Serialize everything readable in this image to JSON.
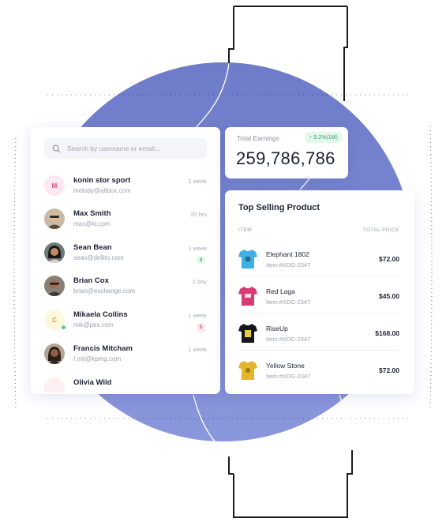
{
  "search": {
    "placeholder": "Search by username or email..."
  },
  "contacts": [
    {
      "name": "konin stor sport",
      "email": "melody@altbox.com",
      "time": "1 week",
      "avatar_initial": "M",
      "badge": ""
    },
    {
      "name": "Max Smith",
      "email": "max@kt.com",
      "time": "20 hrs",
      "avatar_initial": "",
      "badge": ""
    },
    {
      "name": "Sean Bean",
      "email": "sean@dellito.com",
      "time": "1 week",
      "avatar_initial": "",
      "badge": "2"
    },
    {
      "name": "Brian Cox",
      "email": "brian@exchange.com",
      "time": "1 day",
      "avatar_initial": "",
      "badge": ""
    },
    {
      "name": "Mikaela Collins",
      "email": "mik@pex.com",
      "time": "1 week",
      "avatar_initial": "C",
      "badge": "5"
    },
    {
      "name": "Francis Mitcham",
      "email": "f.mit@kpmg.com",
      "time": "1 week",
      "avatar_initial": "",
      "badge": ""
    },
    {
      "name": "Olivia Wild",
      "email": "",
      "time": "",
      "avatar_initial": "",
      "badge": ""
    }
  ],
  "earnings": {
    "label": "Total Earnings",
    "change": "9.2%(1M)",
    "value": "259,786,786"
  },
  "products": {
    "title": "Top Selling Product",
    "col_item": "ITEM",
    "col_price": "TOTAL PRICE",
    "items": [
      {
        "name": "Elephant 1802",
        "sku": "Item:#XDG-2347",
        "price": "$72.00",
        "color": "#3fb0e6"
      },
      {
        "name": "Red Laga",
        "sku": "Item:#XDG-2347",
        "price": "$45.00",
        "color": "#d63c73"
      },
      {
        "name": "RiseUp",
        "sku": "Item:#XDG-2347",
        "price": "$168.00",
        "color": "#15161c"
      },
      {
        "name": "Yellow Stone",
        "sku": "Item:#XDG-2347",
        "price": "$72.00",
        "color": "#e2b52a"
      }
    ]
  },
  "colors": {
    "circle": "#7a86d0",
    "positive": "#21a861",
    "negative": "#e2454f",
    "accent": "#50cd89"
  }
}
